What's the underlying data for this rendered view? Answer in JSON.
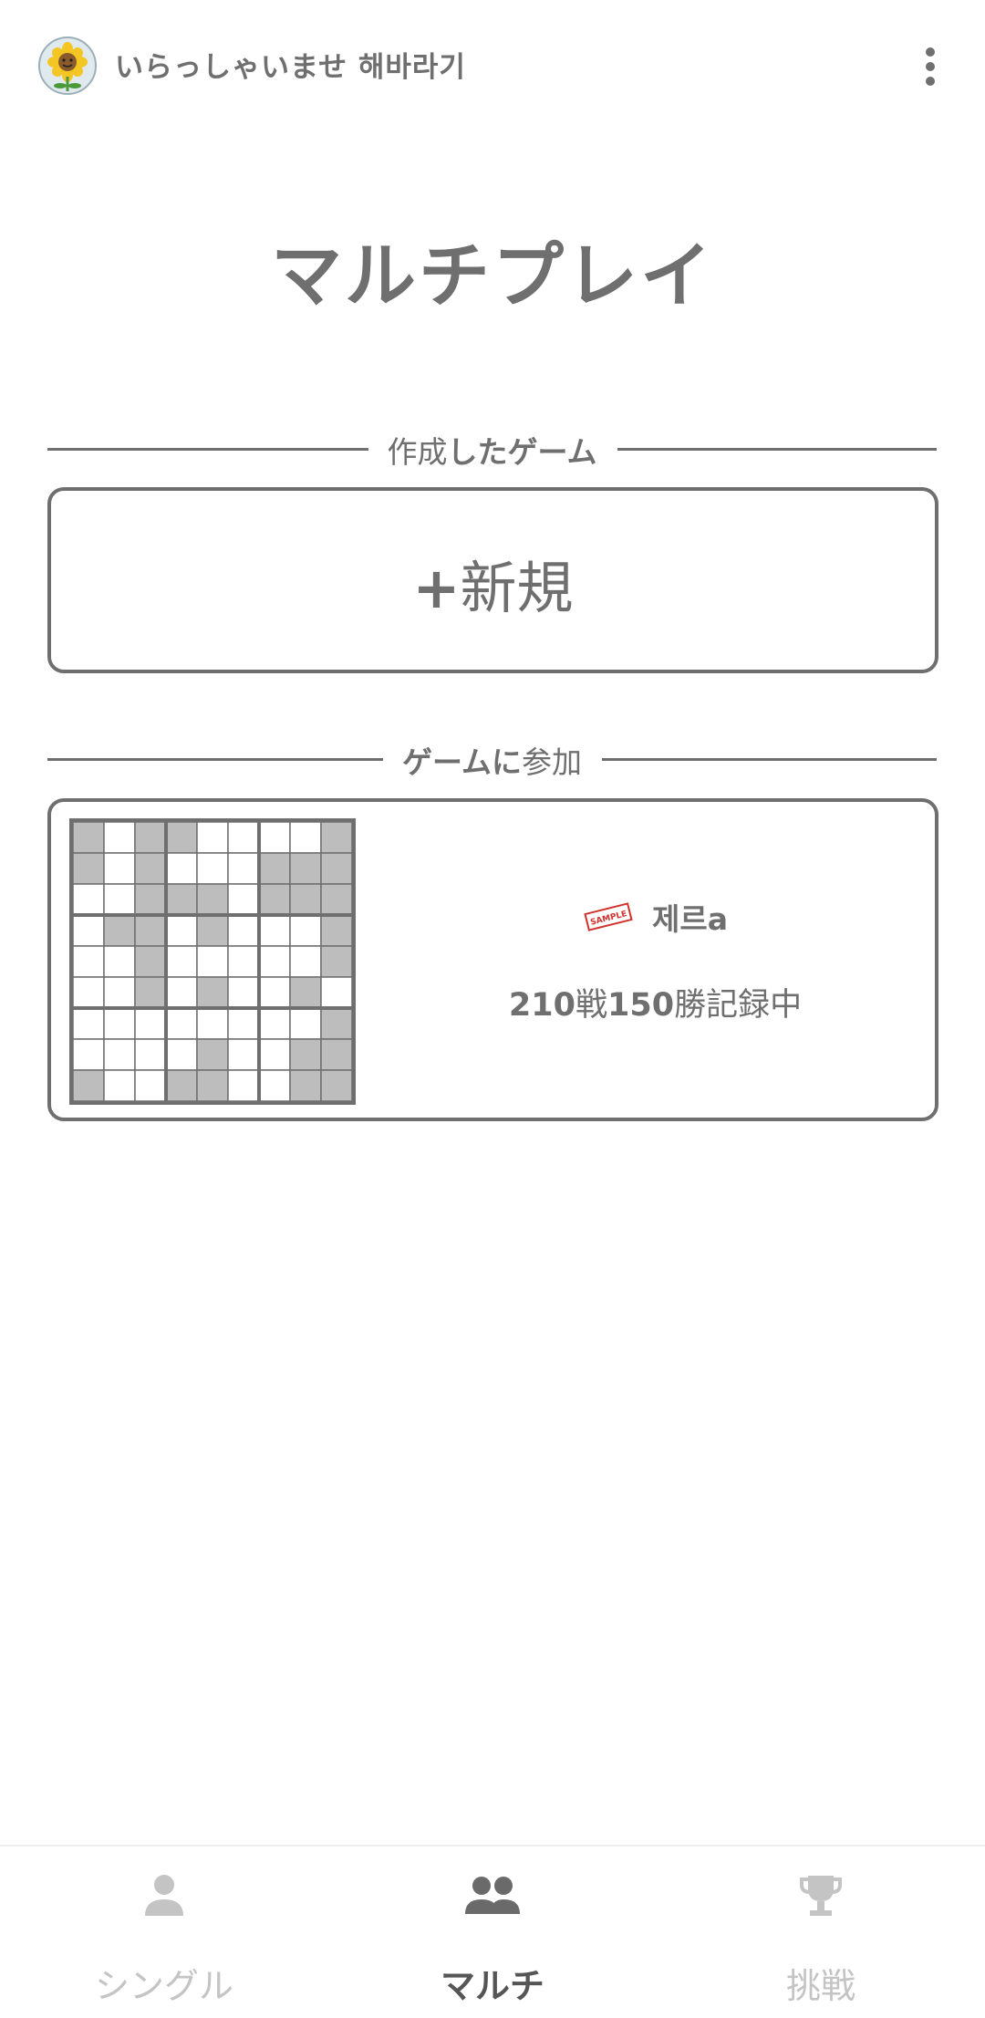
{
  "header": {
    "greeting": "いらっしゃいませ 해바라기",
    "avatar_icon": "sunflower-avatar-icon",
    "menu_icon": "more-vert-icon"
  },
  "page": {
    "title": "マルチプレイ"
  },
  "created_section": {
    "label_light": "作成",
    "label_bold": "したゲーム",
    "new_button": {
      "plus": "+",
      "label": "新規"
    }
  },
  "join_section": {
    "label_bold": "ゲームに",
    "label_light": "参加",
    "game": {
      "stamp_text": "SAMPLE",
      "player_name": "제르a",
      "record": {
        "games": "210",
        "games_unit": "戦",
        "wins": "150",
        "wins_suffix": "勝記録中"
      },
      "board": {
        "size": 9,
        "shaded": [
          "101100001",
          "101000111",
          "001110111",
          "011010001",
          "001000001",
          "001010010",
          "000000001",
          "000010011",
          "100110011"
        ]
      }
    }
  },
  "nav": {
    "items": [
      {
        "label": "シングル",
        "icon": "person-icon",
        "active": false
      },
      {
        "label": "マルチ",
        "icon": "group-icon",
        "active": true
      },
      {
        "label": "挑戦",
        "icon": "trophy-icon",
        "active": false
      }
    ]
  },
  "colors": {
    "text": "#6f6f6f",
    "cell_shaded": "#bdbdbd",
    "nav_inactive": "#c4c4c4",
    "stamp": "#d0312d"
  }
}
